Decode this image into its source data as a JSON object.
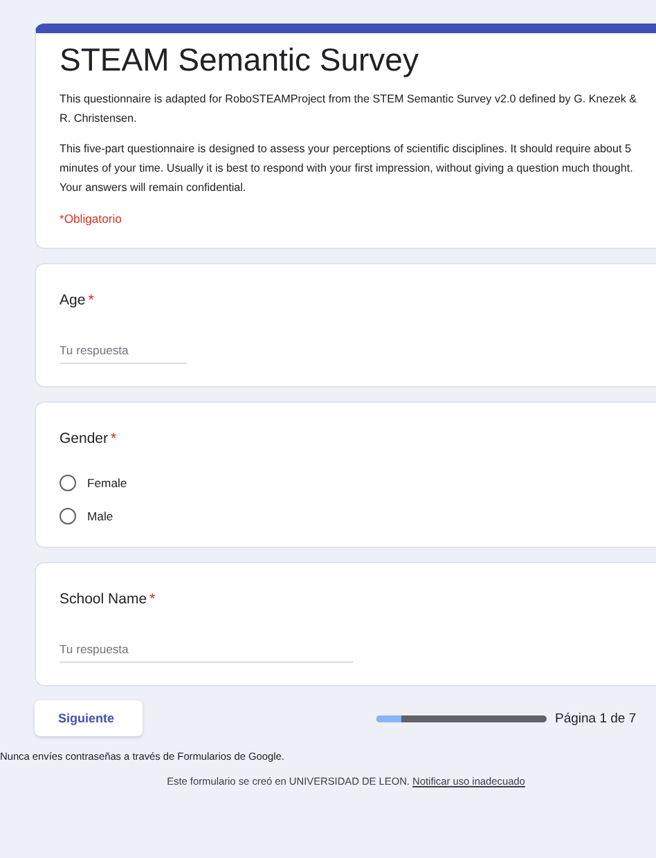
{
  "header": {
    "title": "STEAM Semantic Survey",
    "paragraphs": [
      "This questionnaire is adapted for RoboSTEAMProject from the STEM Semantic Survey v2.0 defined by G. Knezek & R. Christensen.",
      "This five-part questionnaire is designed to assess your perceptions of scientific disciplines. It should require about 5 minutes of your time. Usually it is best to respond with your first impression, without giving a question much thought. Your answers will remain confidential."
    ],
    "required_note": "*Obligatorio"
  },
  "questions": [
    {
      "kind": "text",
      "label": "Age",
      "mark": "*",
      "placeholder": "Tu respuesta",
      "wide": false
    },
    {
      "kind": "radio",
      "label": "Gender",
      "mark": "*",
      "options": [
        {
          "label": "Female",
          "selected": false
        },
        {
          "label": "Male",
          "selected": false
        }
      ]
    },
    {
      "kind": "text",
      "label": "School Name",
      "mark": "*",
      "placeholder": "Tu respuesta",
      "wide": true
    }
  ],
  "next_button": "Siguiente",
  "progress": {
    "level": 0.15,
    "label": "Página 1 de 7"
  },
  "footer": {
    "warning": "Nunca envíes contraseñas a través de Formularios de Google.",
    "credit": "Este formulario se creó en UNIVERSIDAD DE LEON.",
    "link": "Notificar uso inadecuado"
  }
}
